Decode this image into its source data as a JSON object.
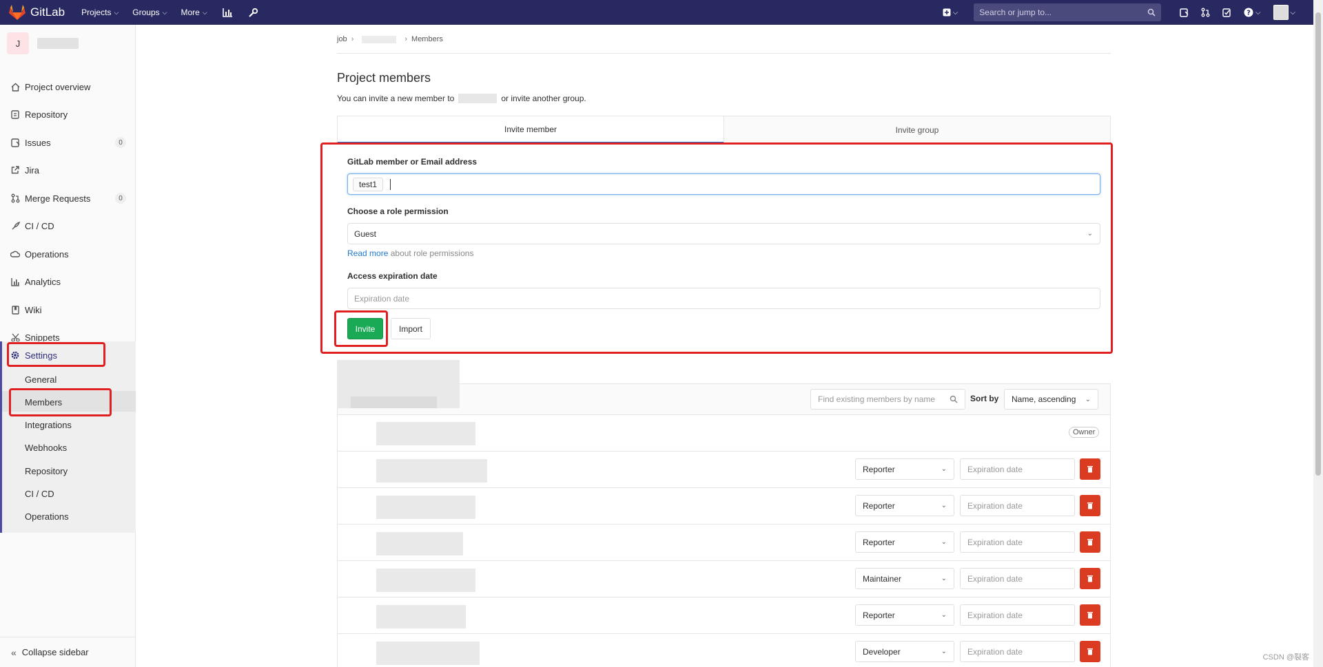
{
  "navbar": {
    "brand": "GitLab",
    "projects": "Projects",
    "groups": "Groups",
    "more": "More",
    "search_placeholder": "Search or jump to..."
  },
  "sidebar": {
    "project_initial": "J",
    "items": [
      {
        "label": "Project overview",
        "icon": "home-icon"
      },
      {
        "label": "Repository",
        "icon": "doc-icon"
      },
      {
        "label": "Issues",
        "icon": "issues-icon",
        "badge": "0"
      },
      {
        "label": "Jira",
        "icon": "external-link-icon"
      },
      {
        "label": "Merge Requests",
        "icon": "merge-request-icon",
        "badge": "0"
      },
      {
        "label": "CI / CD",
        "icon": "rocket-icon"
      },
      {
        "label": "Operations",
        "icon": "cloud-icon"
      },
      {
        "label": "Analytics",
        "icon": "chart-icon"
      },
      {
        "label": "Wiki",
        "icon": "book-icon"
      },
      {
        "label": "Snippets",
        "icon": "scissors-icon"
      }
    ],
    "settings_label": "Settings",
    "settings_sub": [
      "General",
      "Members",
      "Integrations",
      "Webhooks",
      "Repository",
      "CI / CD",
      "Operations"
    ],
    "collapse_label": "Collapse sidebar"
  },
  "breadcrumb": {
    "root": "job",
    "current": "Members"
  },
  "page": {
    "title": "Project members",
    "desc_prefix": "You can invite a new member to",
    "desc_suffix": "or invite another group."
  },
  "tabs": {
    "invite_member": "Invite member",
    "invite_group": "Invite group"
  },
  "form": {
    "member_label": "GitLab member or Email address",
    "member_token": "test1",
    "role_label": "Choose a role permission",
    "role_value": "Guest",
    "read_more_link": "Read more",
    "read_more_text": "about role permissions",
    "expiration_label": "Access expiration date",
    "expiration_placeholder": "Expiration date",
    "invite_button": "Invite",
    "import_button": "Import"
  },
  "members": {
    "search_placeholder": "Find existing members by name",
    "sort_label": "Sort by",
    "sort_value": "Name, ascending",
    "owner_badge": "Owner",
    "rows": [
      {
        "role": "Reporter",
        "expiration_placeholder": "Expiration date"
      },
      {
        "role": "Reporter",
        "expiration_placeholder": "Expiration date"
      },
      {
        "role": "Reporter",
        "expiration_placeholder": "Expiration date"
      },
      {
        "role": "Maintainer",
        "expiration_placeholder": "Expiration date"
      },
      {
        "role": "Reporter",
        "expiration_placeholder": "Expiration date"
      },
      {
        "role": "Developer",
        "expiration_placeholder": "Expiration date"
      }
    ]
  },
  "watermark": "CSDN @裂客",
  "colors": {
    "navbar": "#292961",
    "invite_green": "#1aaa55",
    "delete_red": "#db3b21",
    "annotation_red": "#e02020"
  }
}
